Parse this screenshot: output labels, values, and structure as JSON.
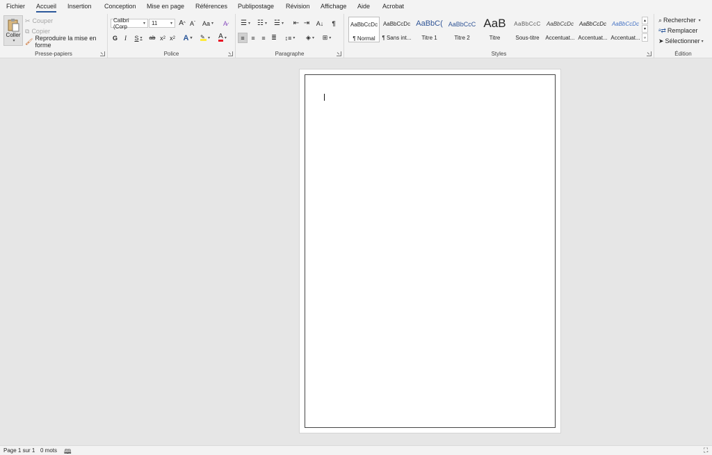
{
  "tabs": [
    "Fichier",
    "Accueil",
    "Insertion",
    "Conception",
    "Mise en page",
    "Références",
    "Publipostage",
    "Révision",
    "Affichage",
    "Aide",
    "Acrobat"
  ],
  "clipboard": {
    "paste": "Coller",
    "cut": "Couper",
    "copy": "Copier",
    "format_painter": "Reproduire la mise en forme",
    "label": "Presse-papiers"
  },
  "font": {
    "family": "Calibri (Corp",
    "size": "11",
    "grow": "A",
    "shrink": "A",
    "case": "Aa",
    "bold": "G",
    "italic": "I",
    "underline": "S",
    "strike": "ab",
    "sub": "x",
    "sup": "x",
    "effects": "A",
    "highlight_icon": "highlighter-icon",
    "color": "A",
    "label": "Police",
    "highlight_color": "#ffeb3b",
    "font_color": "#e81123"
  },
  "paragraph": {
    "label": "Paragraphe",
    "pilcrow": "¶"
  },
  "styles": {
    "label": "Styles",
    "items": [
      {
        "preview": "AaBbCcDc",
        "name": "¶ Normal"
      },
      {
        "preview": "AaBbCcDc",
        "name": "¶ Sans int..."
      },
      {
        "preview": "AaBbC(",
        "name": "Titre 1"
      },
      {
        "preview": "AaBbCcC",
        "name": "Titre 2"
      },
      {
        "preview": "AaB",
        "name": "Titre"
      },
      {
        "preview": "AaBbCcC",
        "name": "Sous-titre"
      },
      {
        "preview": "AaBbCcDc",
        "name": "Accentuat..."
      },
      {
        "preview": "AaBbCcDc",
        "name": "Accentuat..."
      },
      {
        "preview": "AaBbCcDc",
        "name": "Accentuat..."
      }
    ]
  },
  "editing": {
    "find": "Rechercher",
    "replace": "Remplacer",
    "select": "Sélectionner",
    "label": "Édition"
  },
  "status": {
    "page": "Page 1 sur 1",
    "words": "0 mots"
  },
  "colors": {
    "accent": "#2b579a",
    "heading_blue": "#2f5496"
  }
}
